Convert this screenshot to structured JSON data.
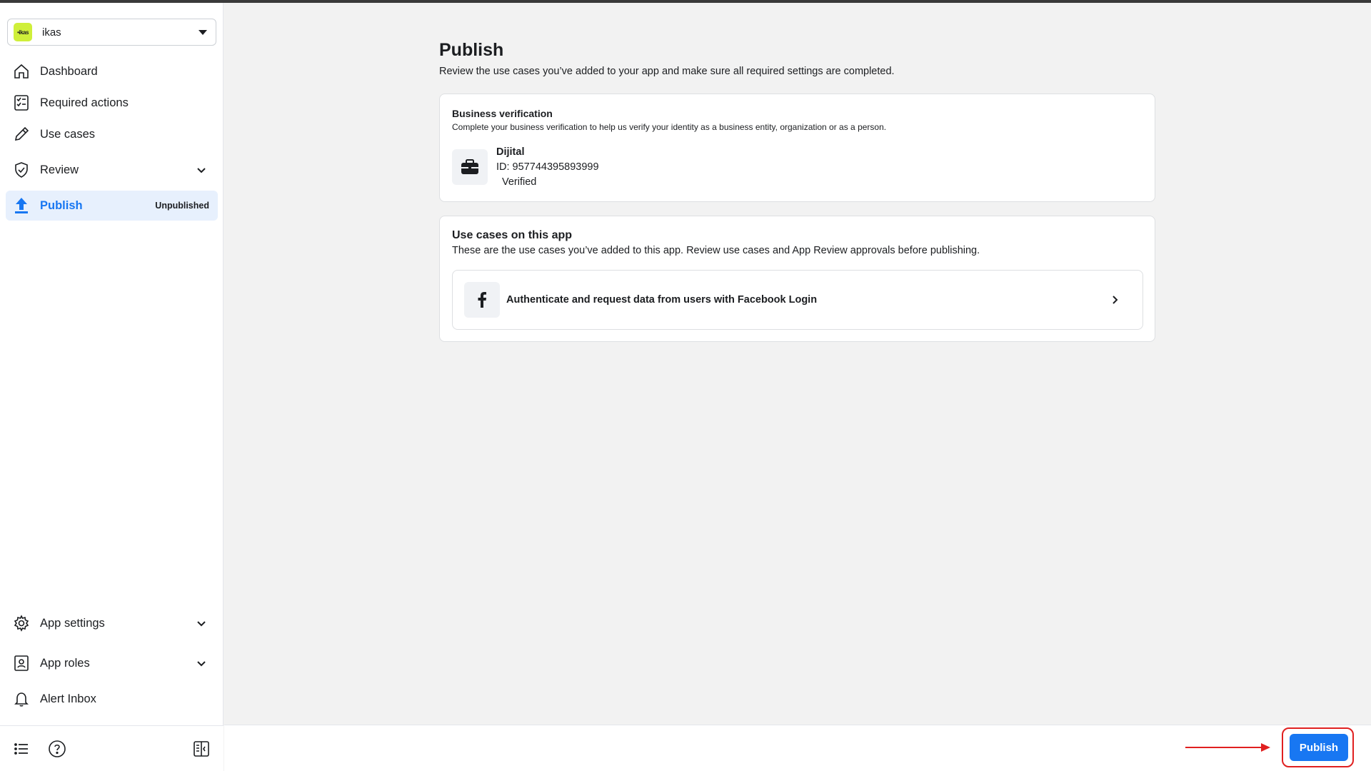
{
  "app": {
    "name": "ikas",
    "logo_text": "•ikas",
    "brand_color": "#cfef3a"
  },
  "sidebar": {
    "items": [
      {
        "label": "Dashboard",
        "icon": "home-icon"
      },
      {
        "label": "Required actions",
        "icon": "checklist-icon"
      },
      {
        "label": "Use cases",
        "icon": "pencil-icon"
      },
      {
        "label": "Review",
        "icon": "shield-check-icon",
        "expandable": true
      },
      {
        "label": "Publish",
        "icon": "upload-icon",
        "active": true,
        "badge": "Unpublished"
      }
    ],
    "bottom_items": [
      {
        "label": "App settings",
        "icon": "gear-icon",
        "expandable": true
      },
      {
        "label": "App roles",
        "icon": "id-badge-icon",
        "expandable": true
      },
      {
        "label": "Alert Inbox",
        "icon": "bell-icon"
      }
    ],
    "footer_icons": [
      "list-icon",
      "help-icon",
      "collapse-sidebar-icon"
    ]
  },
  "main": {
    "title": "Publish",
    "subtitle": "Review the use cases you’ve added to your app and make sure all required settings are completed.",
    "business_verification": {
      "title": "Business verification",
      "description": "Complete your business verification to help us verify your identity as a business entity, organization or as a person.",
      "business_name": "Dijital",
      "business_id": "ID: 957744395893999",
      "status": "Verified"
    },
    "use_cases": {
      "title": "Use cases on this app",
      "description": "These are the use cases you’ve added to this app. Review use cases and App Review approvals before publishing.",
      "items": [
        {
          "label": "Authenticate and request data from users with Facebook Login",
          "icon": "facebook-icon"
        }
      ]
    }
  },
  "footer": {
    "publish_label": "Publish"
  },
  "colors": {
    "accent": "#1877f2",
    "active_bg": "#e7f0fd",
    "annotation": "#e02020"
  }
}
